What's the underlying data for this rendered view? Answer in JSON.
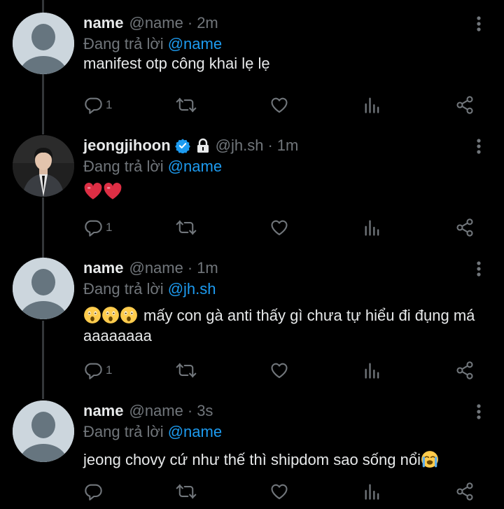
{
  "tweets": [
    {
      "name": "name",
      "handle": "@name",
      "time": "2m",
      "replying_label": "Đang trả lời",
      "replying_to": "@name",
      "text": "manifest otp công khai lẹ lẹ",
      "reply_count": "1",
      "avatar": "default-avatar-icon"
    },
    {
      "name": "jeongjihoon",
      "handle": "@jh.sh",
      "time": "1m",
      "replying_label": "Đang trả lời",
      "replying_to": "@name",
      "text": "",
      "reply_count": "1",
      "avatar": "profile-photo",
      "verified": true,
      "protected": true
    },
    {
      "name": "name",
      "handle": "@name",
      "time": "1m",
      "replying_label": "Đang trả lời",
      "replying_to": "@jh.sh",
      "text": "mấy con gà anti thấy gì chưa tự hiểu đi đụng má aaaaaaaa",
      "reply_count": "1",
      "avatar": "default-avatar-icon"
    },
    {
      "name": "name",
      "handle": "@name",
      "time": "3s",
      "replying_label": "Đang trả lời",
      "replying_to": "@name",
      "text": "jeong chovy cứ như thế thì shipdom sao sống nổi",
      "reply_count": "",
      "avatar": "default-avatar-icon"
    }
  ],
  "colors": {
    "background": "#000000",
    "text": "#e7e9ea",
    "secondary": "#71767b",
    "link": "#1d9bf0",
    "verified": "#1d9bf0"
  },
  "icons": [
    "reply-icon",
    "retweet-icon",
    "like-icon",
    "views-icon",
    "share-icon",
    "more-icon",
    "verified-badge-icon",
    "lock-icon",
    "heart-emoji",
    "astonished-emoji",
    "crying-emoji"
  ]
}
